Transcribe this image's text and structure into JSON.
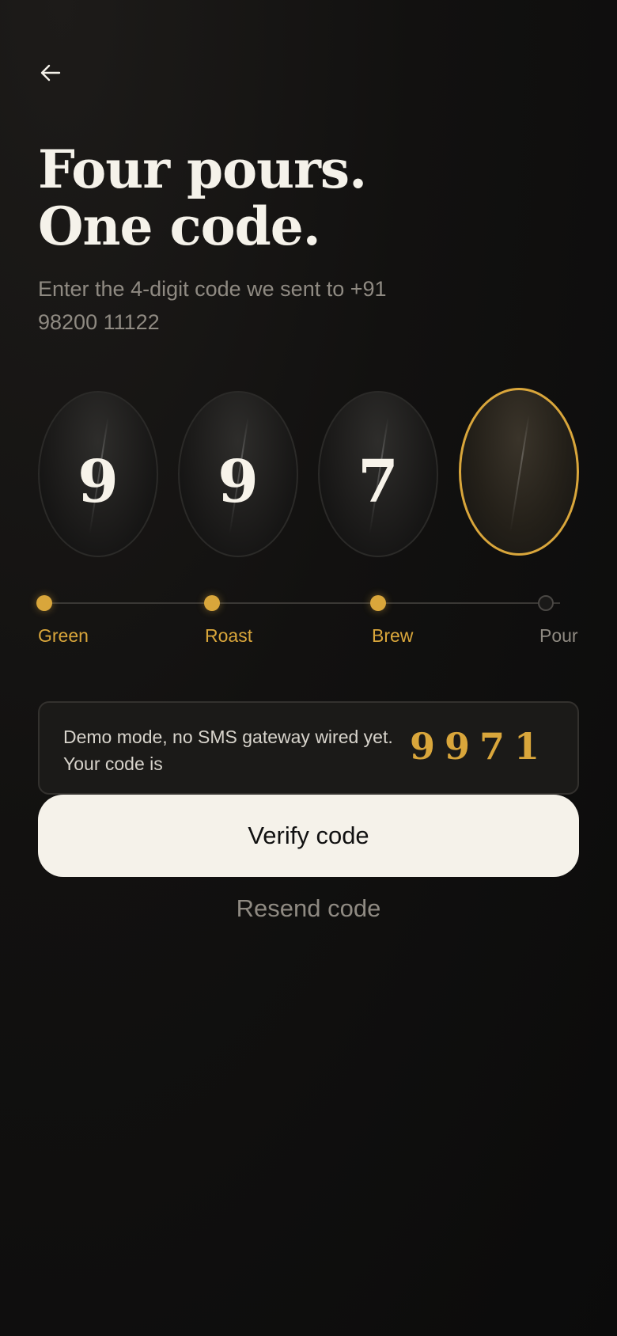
{
  "header": {
    "back_icon": "arrow-left-icon",
    "title_lines": [
      "Four pours.",
      "One code."
    ],
    "subtitle_lines": [
      "Enter the 4-digit code we sent to +91",
      "98200 11122"
    ]
  },
  "otp": {
    "digits": [
      "9",
      "9",
      "7",
      ""
    ],
    "active_index": 3
  },
  "steps": [
    {
      "label": "Green",
      "state": "done"
    },
    {
      "label": "Roast",
      "state": "done"
    },
    {
      "label": "Brew",
      "state": "done"
    },
    {
      "label": "Pour",
      "state": "pending"
    }
  ],
  "demo": {
    "message_lines": [
      "Demo mode, no SMS gateway wired yet.",
      "Your code is"
    ],
    "code": "9971"
  },
  "actions": {
    "verify_label": "Verify code",
    "resend_label": "Resend code"
  },
  "colors": {
    "accent": "#d9a63b",
    "background": "#121110",
    "button": "#f5f2ea",
    "muted_text": "#8f8a82"
  }
}
